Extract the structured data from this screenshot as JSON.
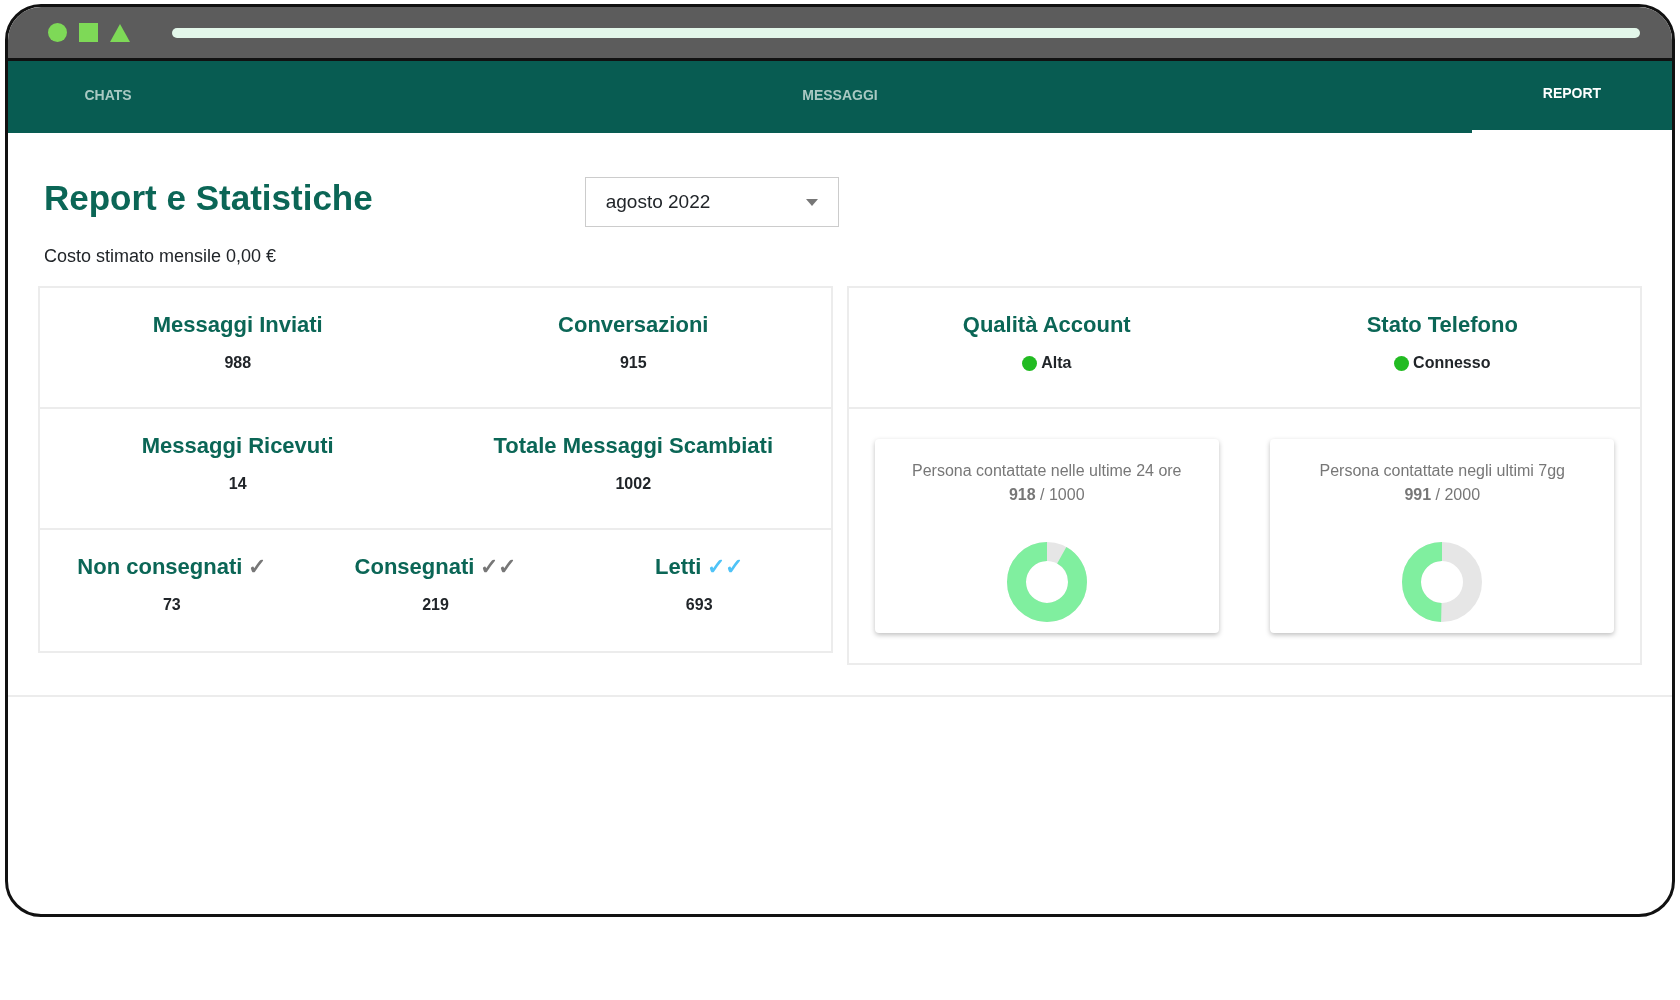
{
  "tabs": [
    {
      "label": "CHATS",
      "selected": false
    },
    {
      "label": "MESSAGGI",
      "selected": false
    },
    {
      "label": "REPORT",
      "selected": true
    }
  ],
  "title": "Report e Statistiche",
  "month_select": {
    "value": "agosto 2022"
  },
  "cost": "Costo stimato mensile 0,00 €",
  "stat_rows": [
    {
      "stats": [
        {
          "label": "Messaggi Inviati",
          "value": "988"
        },
        {
          "label": "Conversazioni",
          "value": "915"
        }
      ]
    },
    {
      "stats": [
        {
          "label": "Messaggi Ricevuti",
          "value": "14"
        },
        {
          "label": "Totale Messaggi Scambiati",
          "value": "1002"
        }
      ]
    },
    {
      "stats": [
        {
          "label": "Non consegnati",
          "ticks": "✓",
          "color": "#777777",
          "value": "73"
        },
        {
          "label": "Consegnati",
          "ticks": "✓✓",
          "color": "#777777",
          "value": "219"
        },
        {
          "label": "Letti",
          "ticks": "✓✓",
          "color": "#4fc3f7",
          "value": "693"
        }
      ]
    }
  ],
  "status": [
    {
      "label": "Qualità Account",
      "value": "Alta",
      "color": "#22bb22"
    },
    {
      "label": "Stato Telefono",
      "value": "Connesso",
      "color": "#22bb22"
    }
  ],
  "gauges": [
    {
      "title": "Persona contattate nelle ultime 24 ore",
      "count": "918",
      "limit": "/ 1000",
      "level": 0.918
    },
    {
      "title": "Persona contattate negli ultimi 7gg",
      "count": "991",
      "limit": "/ 2000",
      "level": 0.4955
    }
  ]
}
